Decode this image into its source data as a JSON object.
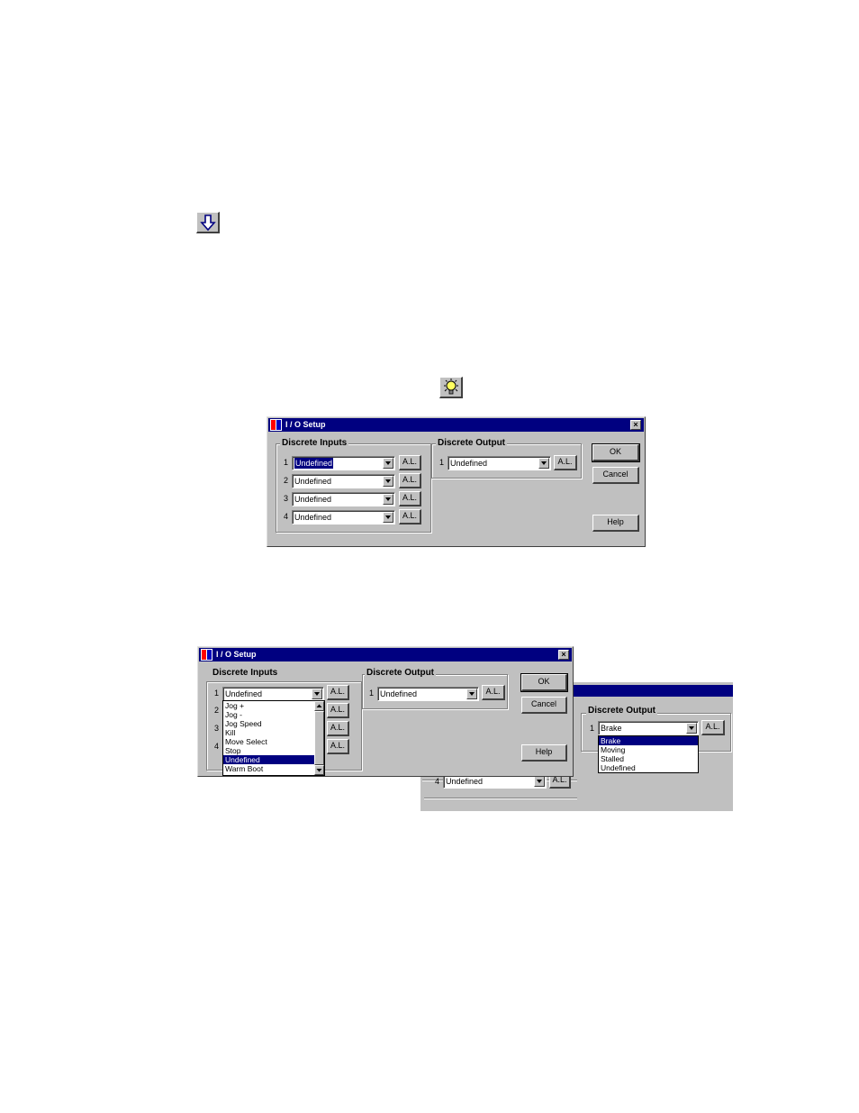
{
  "toolbar_icons": [
    {
      "name": "download-arrow-icon"
    },
    {
      "name": "lightbulb-icon"
    }
  ],
  "dialog1": {
    "title": "I / O Setup",
    "close_glyph": "×",
    "inputs_label": "Discrete Inputs",
    "output_label": "Discrete Output",
    "inputs": [
      {
        "num": "1",
        "value": "Undefined",
        "al": "A.L."
      },
      {
        "num": "2",
        "value": "Undefined",
        "al": "A.L."
      },
      {
        "num": "3",
        "value": "Undefined",
        "al": "A.L."
      },
      {
        "num": "4",
        "value": "Undefined",
        "al": "A.L."
      }
    ],
    "output": {
      "num": "1",
      "value": "Undefined",
      "al": "A.L."
    },
    "ok": "OK",
    "cancel": "Cancel",
    "help": "Help"
  },
  "dialog2": {
    "title": "I / O Setup",
    "close_glyph": "×",
    "inputs_label": "Discrete Inputs",
    "output_label": "Discrete Output",
    "input1": {
      "num": "1",
      "value": "Undefined",
      "al": "A.L."
    },
    "hidden_nums": [
      "2",
      "3",
      "4"
    ],
    "al": "A.L.",
    "dropdown_options": [
      "Jog +",
      "Jog -",
      "Jog Speed",
      "Kill",
      "Move Select",
      "Stop",
      "Undefined",
      "Warm Boot"
    ],
    "dropdown_selected": "Undefined",
    "output": {
      "num": "1",
      "value": "Undefined",
      "al": "A.L."
    },
    "ok": "OK",
    "cancel": "Cancel",
    "help": "Help"
  },
  "dialog3": {
    "output_label": "Discrete Output",
    "output": {
      "num": "1",
      "value": "Brake",
      "al": "A.L."
    },
    "dropdown_options": [
      "Brake",
      "Moving",
      "Stalled",
      "Undefined"
    ],
    "dropdown_selected": "Brake",
    "input4": {
      "num": "4",
      "value": "Undefined",
      "al": "A.L."
    }
  }
}
